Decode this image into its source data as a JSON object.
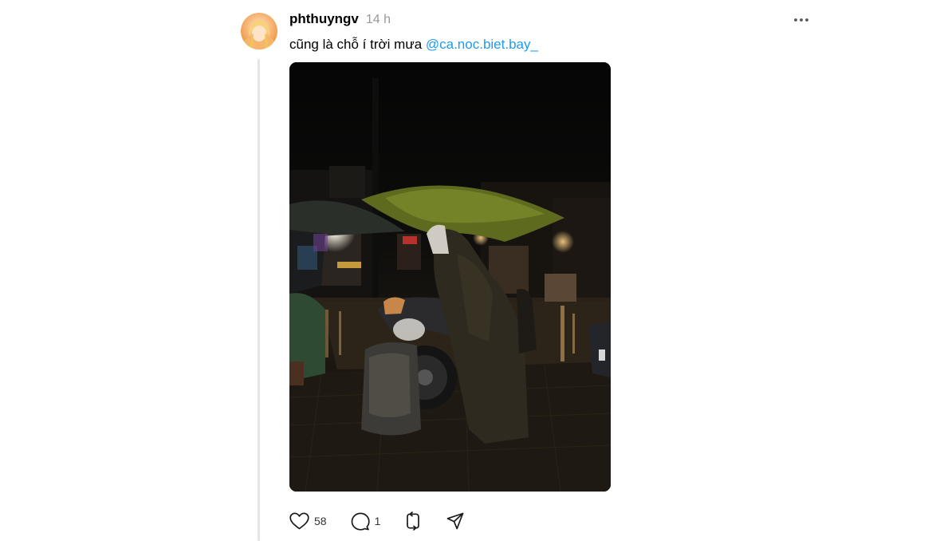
{
  "post": {
    "username": "phthuyngv",
    "time": "14 h",
    "text": "cũng là chỗ í trời mưa ",
    "mention": "@ca.noc.biet.bay_"
  },
  "actions": {
    "like_count": "58",
    "reply_count": "1"
  },
  "icons": {
    "more": "more-horizontal-icon",
    "like": "heart-icon",
    "reply": "speech-bubble-icon",
    "repost": "repost-arrows-icon",
    "share": "send-icon"
  },
  "colors": {
    "mention": "#1d9bf0",
    "timestamp": "#999999",
    "thread_line": "#e5e5e5"
  }
}
